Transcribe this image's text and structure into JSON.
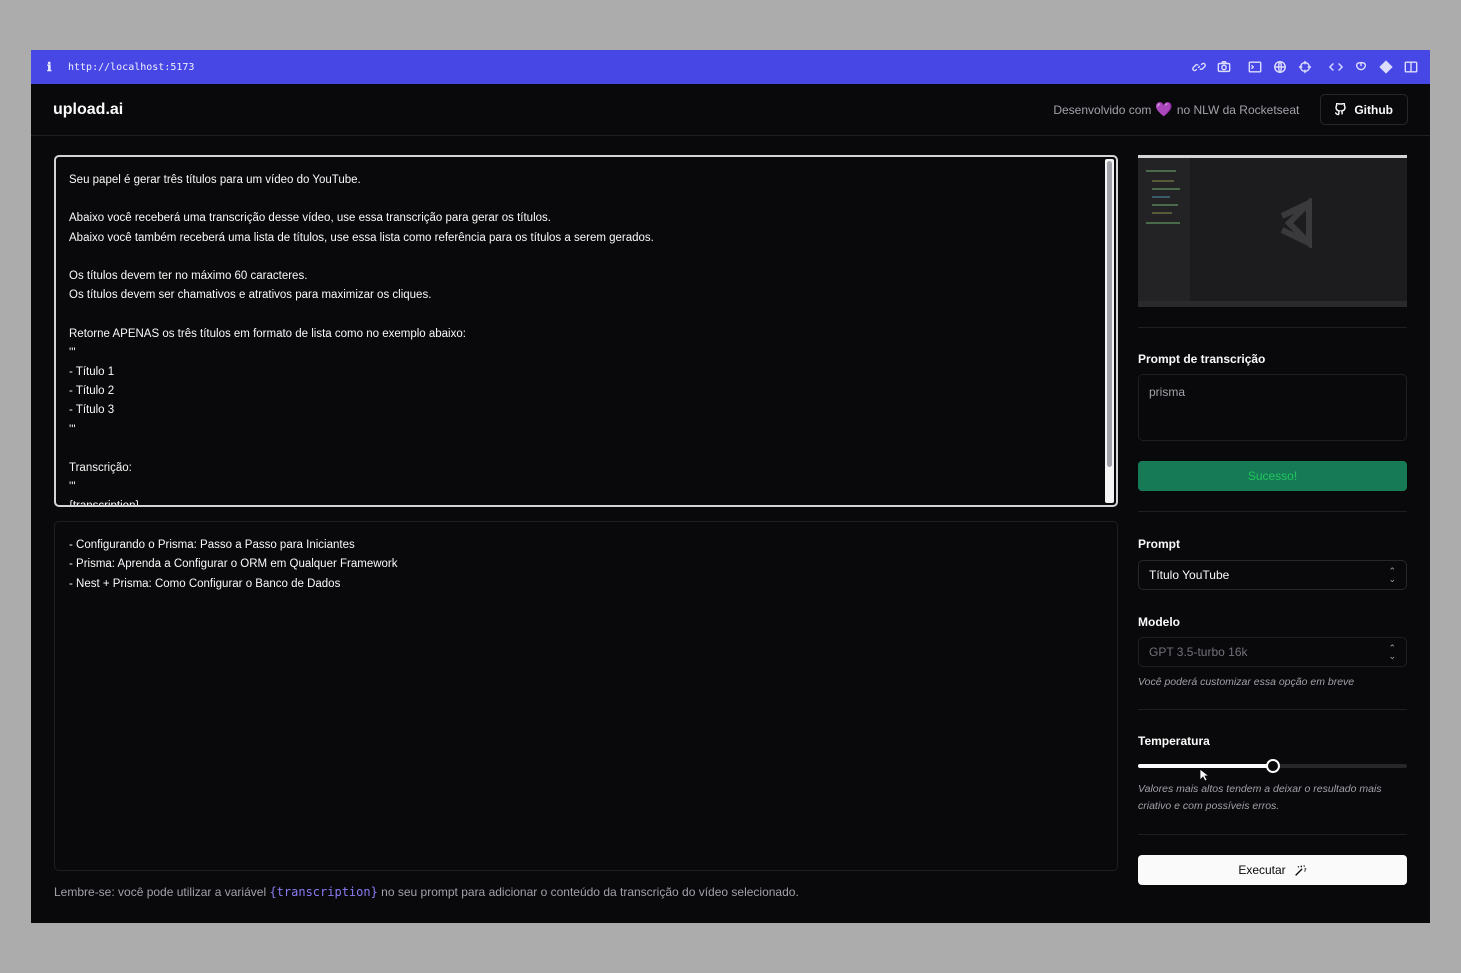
{
  "browser": {
    "url": "http://localhost:5173",
    "tools": [
      "link-icon",
      "camera-icon",
      "terminal-icon",
      "globe-icon",
      "crosshair-icon",
      "code-icon",
      "mouse-icon",
      "diamond-icon",
      "sidebar-icon"
    ]
  },
  "header": {
    "brand": "upload.ai",
    "credit_before": "Desenvolvido com",
    "credit_after": "no NLW da Rocketseat",
    "github_label": "Github"
  },
  "prompt_text": "Seu papel é gerar três títulos para um vídeo do YouTube.\n\nAbaixo você receberá uma transcrição desse vídeo, use essa transcrição para gerar os títulos.\nAbaixo você também receberá uma lista de títulos, use essa lista como referência para os títulos a serem gerados.\n\nOs títulos devem ter no máximo 60 caracteres.\nOs títulos devem ser chamativos e atrativos para maximizar os cliques.\n\nRetorne APENAS os três títulos em formato de lista como no exemplo abaixo:\n'''\n- Título 1\n- Título 2\n- Título 3\n'''\n\nTranscrição:\n'''\n{transcription}",
  "result_text": "- Configurando o Prisma: Passo a Passo para Iniciantes\n- Prisma: Aprenda a Configurar o ORM em Qualquer Framework\n- Nest + Prisma: Como Configurar o Banco de Dados",
  "hint": {
    "before": "Lembre-se: você pode utilizar a variável",
    "variable": "{transcription}",
    "after": "no seu prompt para adicionar o conteúdo da transcrição do vídeo selecionado."
  },
  "sidebar": {
    "transcription_label": "Prompt de transcrição",
    "transcription_value": "prisma",
    "upload_status": "Sucesso!",
    "prompt_label": "Prompt",
    "prompt_selected": "Título YouTube",
    "model_label": "Modelo",
    "model_selected": "GPT 3.5-turbo 16k",
    "model_note": "Você poderá customizar essa opção em breve",
    "temperature_label": "Temperatura",
    "temperature_value": 0.5,
    "temperature_note": "Valores mais altos tendem a deixar o resultado mais criativo e com possíveis erros.",
    "run_label": "Executar"
  },
  "colors": {
    "browser_bar": "#4747e6",
    "background": "#09090b",
    "success": "#157a55",
    "variable": "#8b7cf6"
  }
}
